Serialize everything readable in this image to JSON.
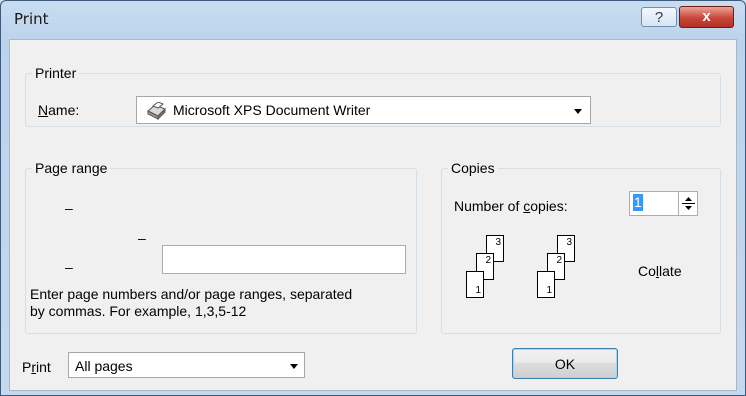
{
  "window": {
    "title": "Print"
  },
  "titlebar": {
    "help_symbol": "?",
    "close_symbol": "x"
  },
  "printer": {
    "group_label": "Printer",
    "name_label_accel": "N",
    "name_label_rest": "ame:",
    "selected_printer": "Microsoft XPS Document Writer",
    "icon": "printer-icon"
  },
  "page_range": {
    "group_label": "Page range",
    "dash": "–",
    "help_text_line1": "Enter page numbers and/or page ranges, separated",
    "help_text_line2": "by commas. For example, 1,3,5-12",
    "pages_value": ""
  },
  "copies": {
    "group_label": "Copies",
    "number_label_pre": "Number of ",
    "number_label_accel": "c",
    "number_label_post": "opies:",
    "count": "1",
    "collate_pre": "Co",
    "collate_accel": "l",
    "collate_post": "late",
    "page_numbers": [
      "1",
      "2",
      "3"
    ]
  },
  "footer": {
    "print_label_pre": "P",
    "print_label_accel": "r",
    "print_label_post": "int",
    "print_what_value": "All pages",
    "ok_label": "OK"
  }
}
